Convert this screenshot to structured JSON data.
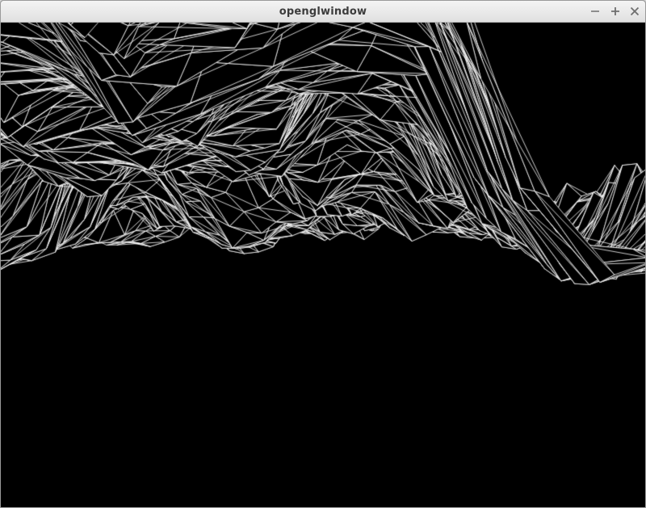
{
  "window": {
    "title": "openglwindow",
    "controls": {
      "minimize_icon": "minimize-icon",
      "maximize_icon": "maximize-icon",
      "close_icon": "close-icon"
    }
  },
  "scene": {
    "type": "wireframe-terrain",
    "background_color": "#000000",
    "line_color": "#ffffff"
  }
}
